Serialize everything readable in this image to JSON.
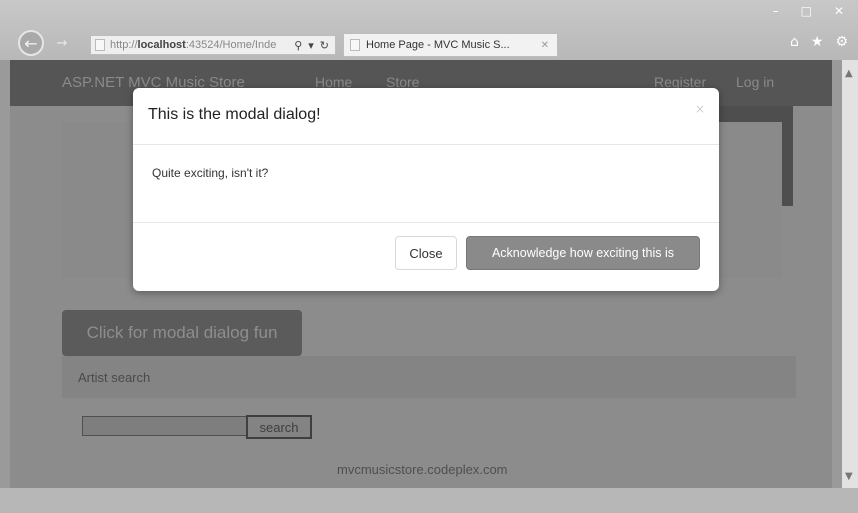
{
  "browser": {
    "window_controls": [
      "–",
      "□",
      "✕"
    ],
    "address_bar": {
      "url_prefix": "http://",
      "url_host": "localhost",
      "url_rest": ":43524/Home/Inde",
      "search_glyph": "⚲",
      "dropdown_glyph": "▾",
      "refresh_glyph": "↻"
    },
    "tab": {
      "title": "Home Page - MVC Music S...",
      "close": "✕"
    },
    "icons": [
      "home-icon",
      "favorites-star-icon",
      "settings-gear-icon"
    ]
  },
  "site": {
    "brand": "ASP.NET MVC Music Store",
    "nav": {
      "home": "Home",
      "store": "Store",
      "register": "Register",
      "login": "Log in"
    },
    "modal_button": "Click for modal dialog fun",
    "artist_search": {
      "title": "Artist search",
      "input_value": "",
      "button": "search"
    },
    "footer": "mvcmusicstore.codeplex.com"
  },
  "modal": {
    "title": "This is the modal dialog!",
    "close_glyph": "×",
    "body": "Quite exciting, isn't it?",
    "buttons": {
      "close": "Close",
      "acknowledge": "Acknowledge how exciting this is"
    }
  },
  "colors": {
    "overlay_page": "#8c8c8c",
    "navbar": "#555555",
    "modal_bg": "#ffffff",
    "primary_button": "#8a8a8a"
  }
}
